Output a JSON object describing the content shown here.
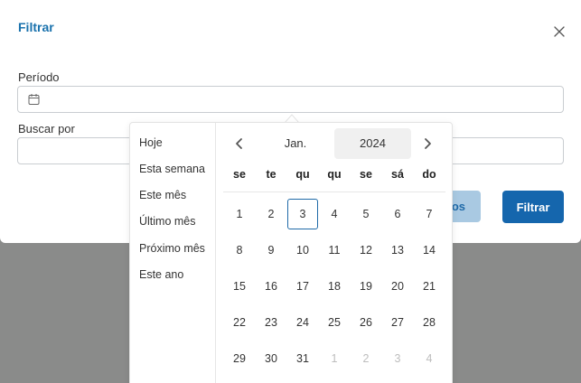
{
  "modal": {
    "title": "Filtrar",
    "period_label": "Período",
    "period_value": "",
    "search_label": "Buscar por",
    "search_value": "",
    "secondary_button_label": "os",
    "filter_button_label": "Filtrar"
  },
  "ranges": [
    "Hoje",
    "Esta semana",
    "Este mês",
    "Último mês",
    "Próximo mês",
    "Este ano"
  ],
  "calendar": {
    "month": "Jan.",
    "year": "2024",
    "weekdays": [
      "se",
      "te",
      "qu",
      "qu",
      "se",
      "sá",
      "do"
    ],
    "weeks": [
      [
        "1",
        "2",
        "3",
        "4",
        "5",
        "6",
        "7"
      ],
      [
        "8",
        "9",
        "10",
        "11",
        "12",
        "13",
        "14"
      ],
      [
        "15",
        "16",
        "17",
        "18",
        "19",
        "20",
        "21"
      ],
      [
        "22",
        "23",
        "24",
        "25",
        "26",
        "27",
        "28"
      ],
      [
        "29",
        "30",
        "31",
        "1",
        "2",
        "3",
        "4"
      ]
    ],
    "today": "3",
    "muted_from_week5_col": 3
  },
  "colors": {
    "accent": "#1a72ad",
    "primary_button": "#1566ad",
    "secondary_button": "#a9c9e2",
    "backdrop": "#8a8b8a"
  },
  "icons": {
    "close": "close-icon",
    "calendar": "calendar-icon",
    "prev": "chevron-left-icon",
    "next": "chevron-right-icon"
  }
}
